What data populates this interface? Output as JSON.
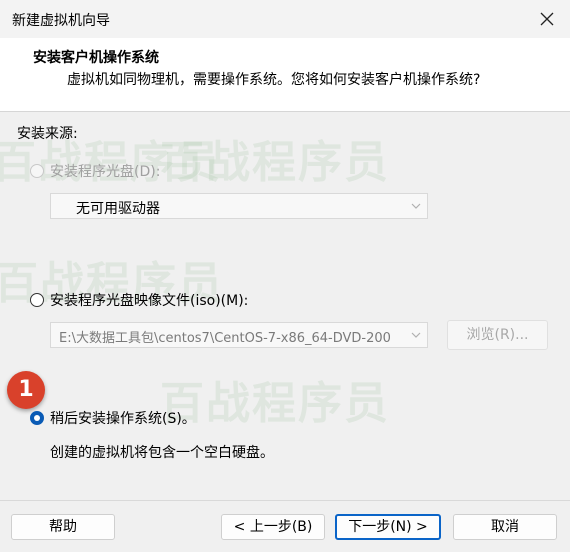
{
  "window": {
    "title": "新建虚拟机向导"
  },
  "header": {
    "title": "安装客户机操作系统",
    "subtitle": "虚拟机如同物理机，需要操作系统。您将如何安装客户机操作系统?"
  },
  "install_source": {
    "label": "安装来源:",
    "disc_option": {
      "label": "安装程序光盘(D):",
      "selected": false,
      "enabled": false
    },
    "disc_drive_select": {
      "value": "无可用驱动器",
      "enabled": false
    },
    "iso_option": {
      "label": "安装程序光盘映像文件(iso)(M):",
      "selected": false,
      "enabled": true
    },
    "iso_path_select": {
      "value": "E:\\大数据工具包\\centos7\\CentOS-7-x86_64-DVD-200",
      "enabled": false
    },
    "browse_button": {
      "label": "浏览(R)...",
      "enabled": false
    },
    "later_option": {
      "label": "稍后安装操作系统(S)。",
      "selected": true,
      "enabled": true
    },
    "later_description": "创建的虚拟机将包含一个空白硬盘。"
  },
  "annotation": {
    "step_number": "1",
    "color": "#d9412b"
  },
  "watermark": {
    "text": "百战程序员"
  },
  "footer": {
    "help_label": "帮助",
    "back_label": "< 上一步(B)",
    "next_label": "下一步(N) >",
    "cancel_label": "取消"
  },
  "colors": {
    "accent": "#0a64c8",
    "badge": "#d9412b"
  }
}
